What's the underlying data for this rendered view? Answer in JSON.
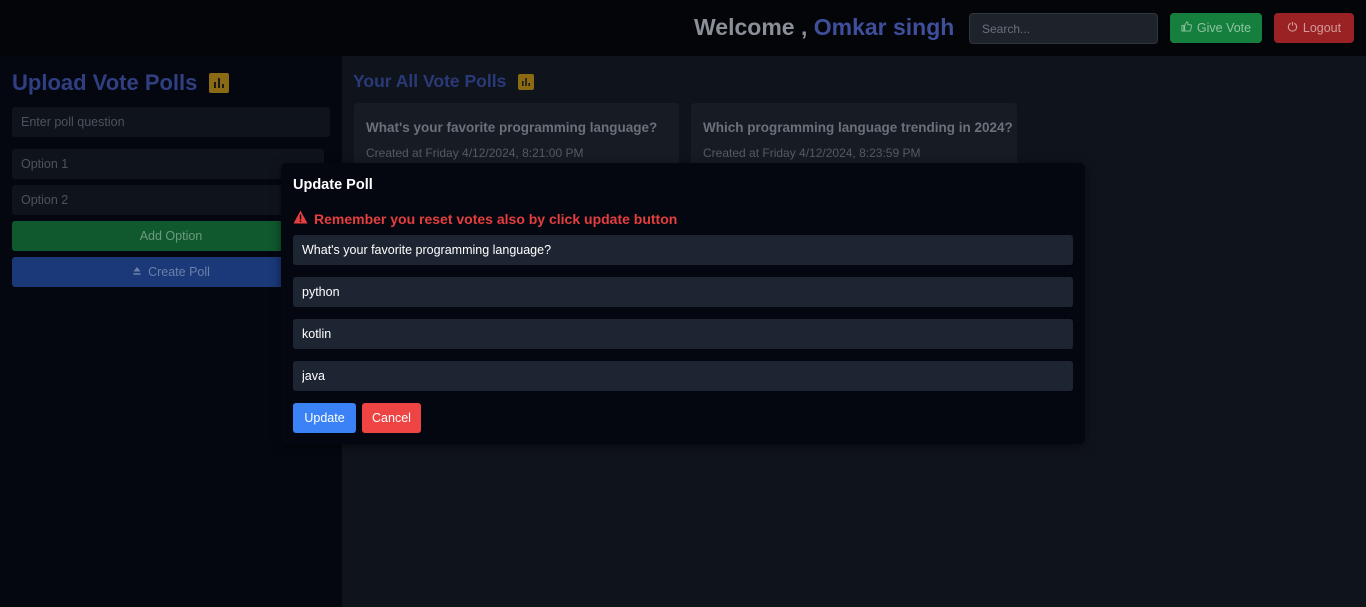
{
  "header": {
    "welcome_prefix": "Welcome ,",
    "user_name": "Omkar singh",
    "search_placeholder": "Search...",
    "give_vote_label": "Give Vote",
    "logout_label": "Logout"
  },
  "sidebar": {
    "title": "Upload Vote Polls",
    "question_placeholder": "Enter poll question",
    "option1_placeholder": "Option 1",
    "option2_placeholder": "Option 2",
    "add_option_label": "Add Option",
    "create_poll_label": "Create Poll"
  },
  "main": {
    "title": "Your All Vote Polls",
    "polls": [
      {
        "question": "What's your favorite programming language?",
        "created": "Created at Friday 4/12/2024, 8:21:00 PM"
      },
      {
        "question": "Which programming language trending in 2024?",
        "created": "Created at Friday 4/12/2024, 8:23:59 PM"
      }
    ]
  },
  "modal": {
    "title": "Update Poll",
    "warning": "Remember you reset votes also by click update button",
    "question_value": "What's your favorite programming language?",
    "options": [
      "python",
      "kotlin",
      "java"
    ],
    "update_label": "Update",
    "cancel_label": "Cancel"
  },
  "colors": {
    "accent_blue": "#3b82f6",
    "danger_red": "#ef4444",
    "success_green": "#15803d",
    "warning_text": "#e53e3e",
    "chart_icon": "#d4a017"
  }
}
